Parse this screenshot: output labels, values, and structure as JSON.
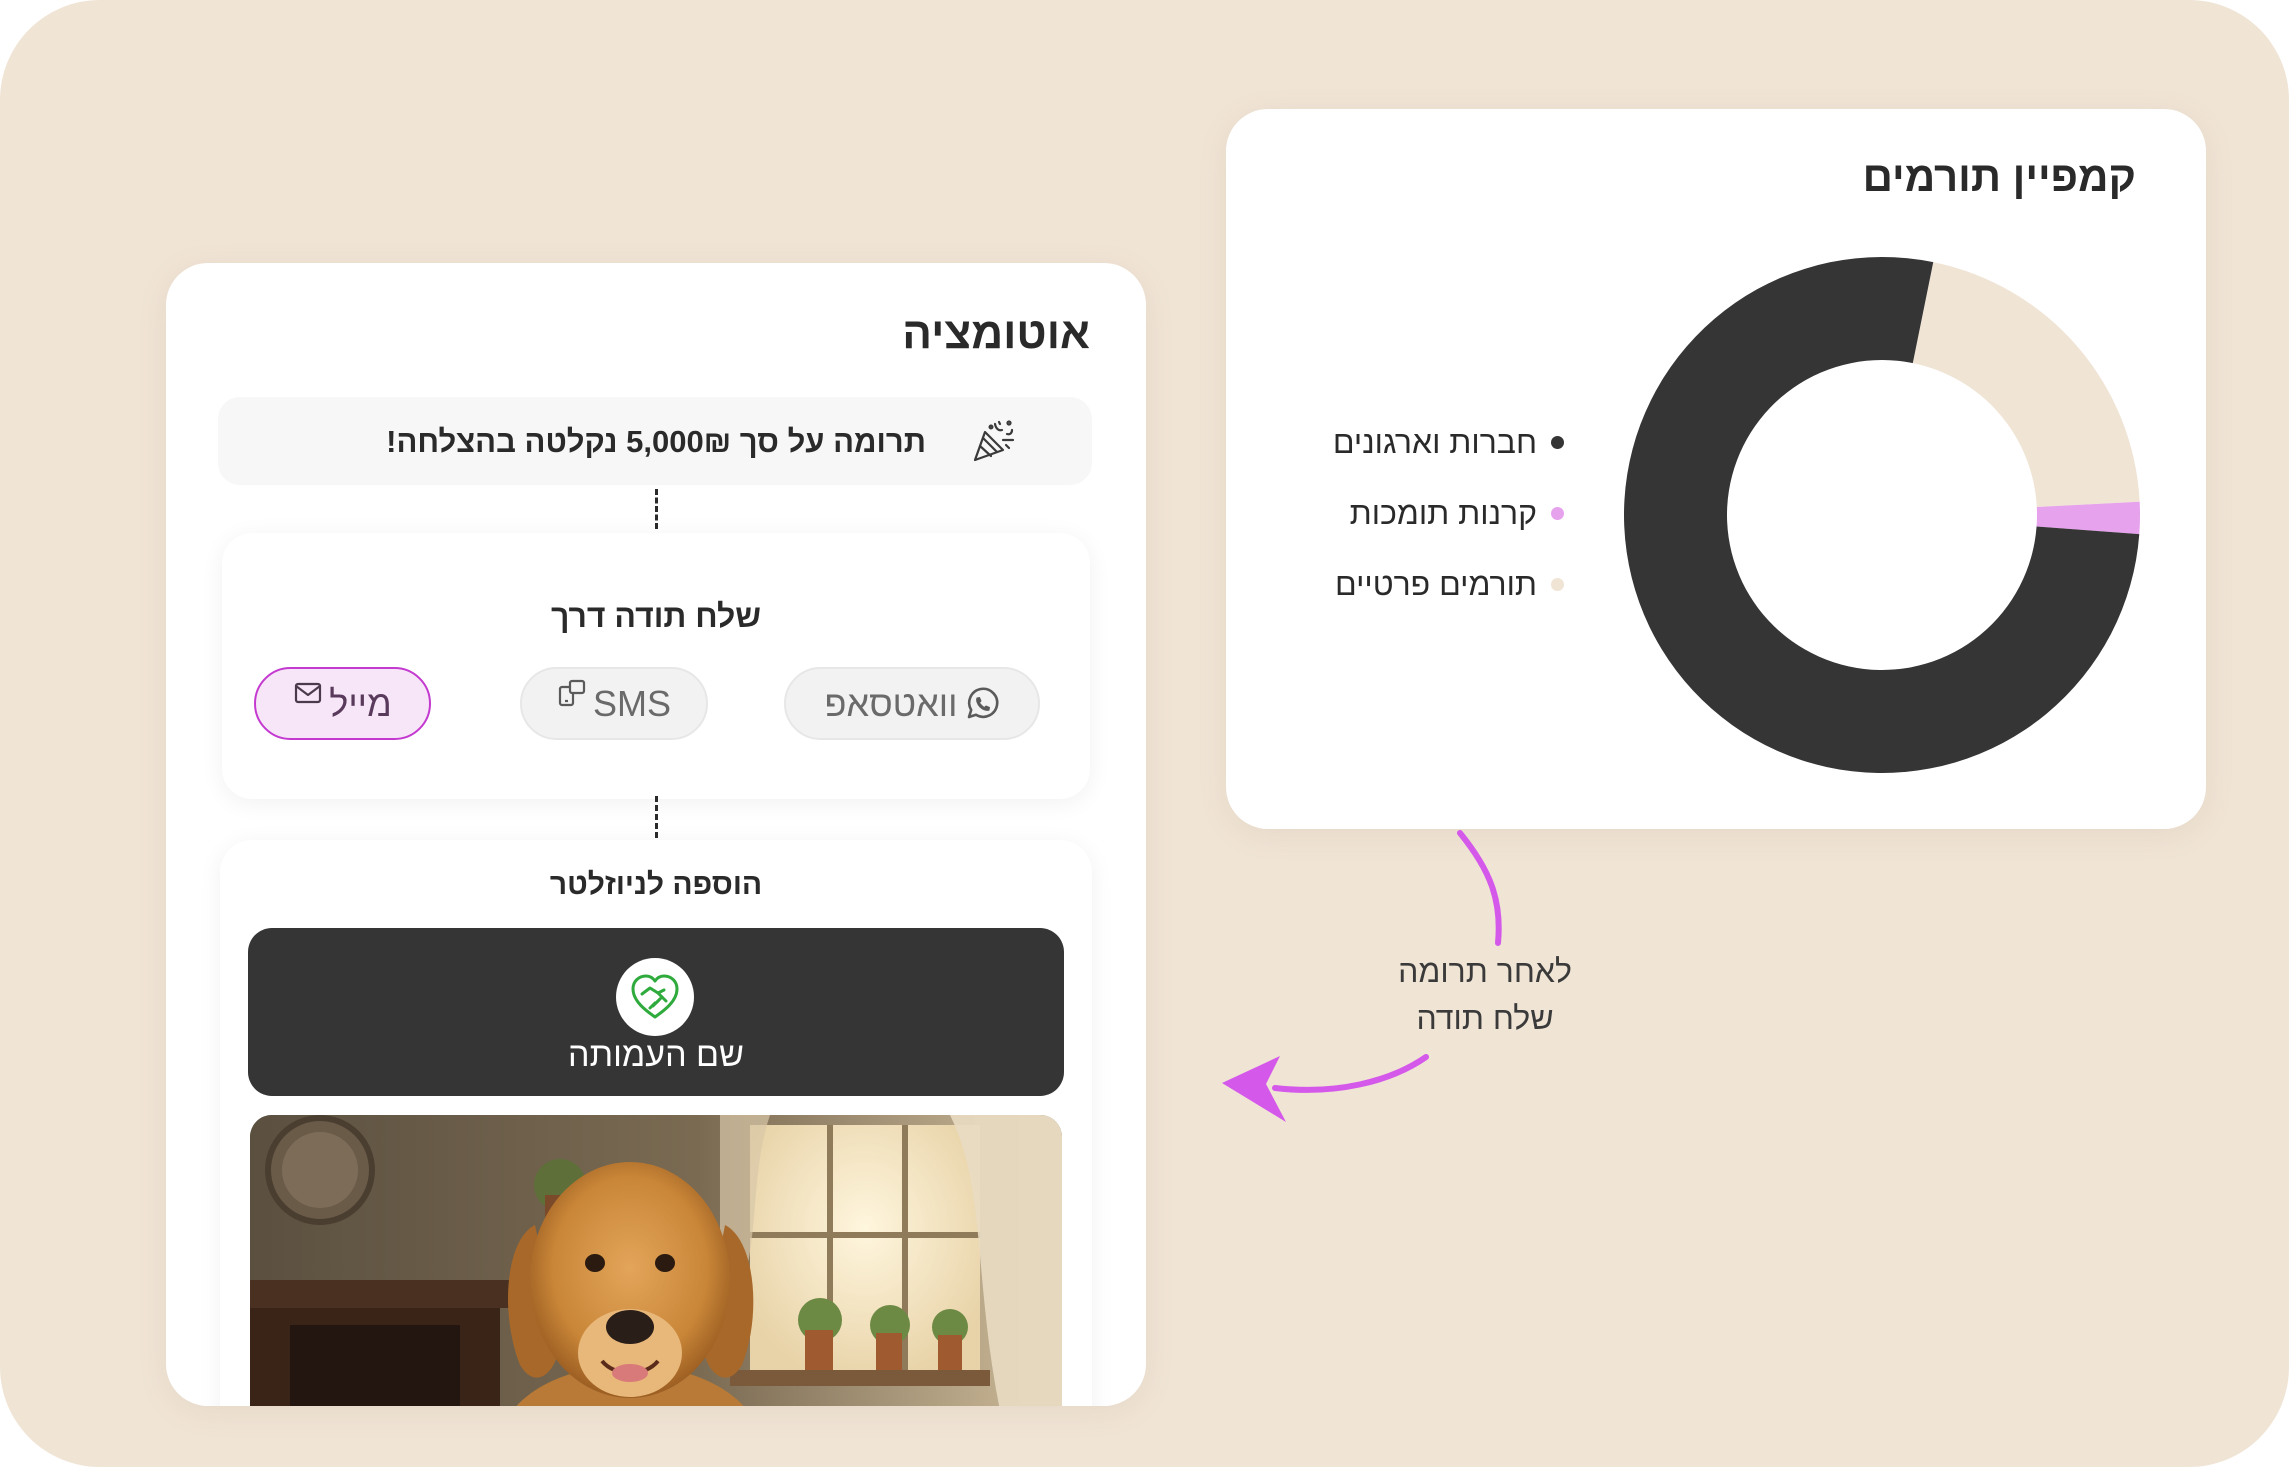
{
  "automation": {
    "title": "אוטומציה",
    "trigger": {
      "icon": "party-popper-icon",
      "text": "תרומה על סך 5,000₪ נקלטה בהצלחה!"
    },
    "send_thanks": {
      "title": "שלח תודה דרך",
      "channels": [
        {
          "label": "וואטסאפ",
          "icon": "whatsapp-icon",
          "selected": false
        },
        {
          "label": "SMS",
          "icon": "sms-icon",
          "selected": false
        },
        {
          "label": "מייל",
          "icon": "mail-icon",
          "selected": true
        }
      ]
    },
    "newsletter": {
      "title": "הוספה לניוזלטר",
      "org_name": "שם העמותה",
      "org_logo_icon": "heart-handshake-icon",
      "image": "golden-retriever-photo"
    }
  },
  "campaign": {
    "title": "קמפיין תורמים",
    "chart_data": {
      "type": "pie",
      "donut": true,
      "categories": [
        "חברות וארגונים",
        "קרנות תומכות",
        "תורמים פרטיים"
      ],
      "values": [
        77,
        2,
        21
      ],
      "colors": [
        "#353535",
        "#e6a2ec",
        "#f0e4d5"
      ],
      "legend": "left"
    }
  },
  "annotation": {
    "line1": "לאחר תרומה",
    "line2": "שלח תודה",
    "arrow_color": "#d459ea"
  },
  "colors": {
    "background": "#f0e4d5",
    "card": "#ffffff",
    "dark": "#353535",
    "accent_pink": "#d459ea",
    "selected_chip_border": "#c43ad0",
    "selected_chip_bg": "#f7e6f8"
  }
}
